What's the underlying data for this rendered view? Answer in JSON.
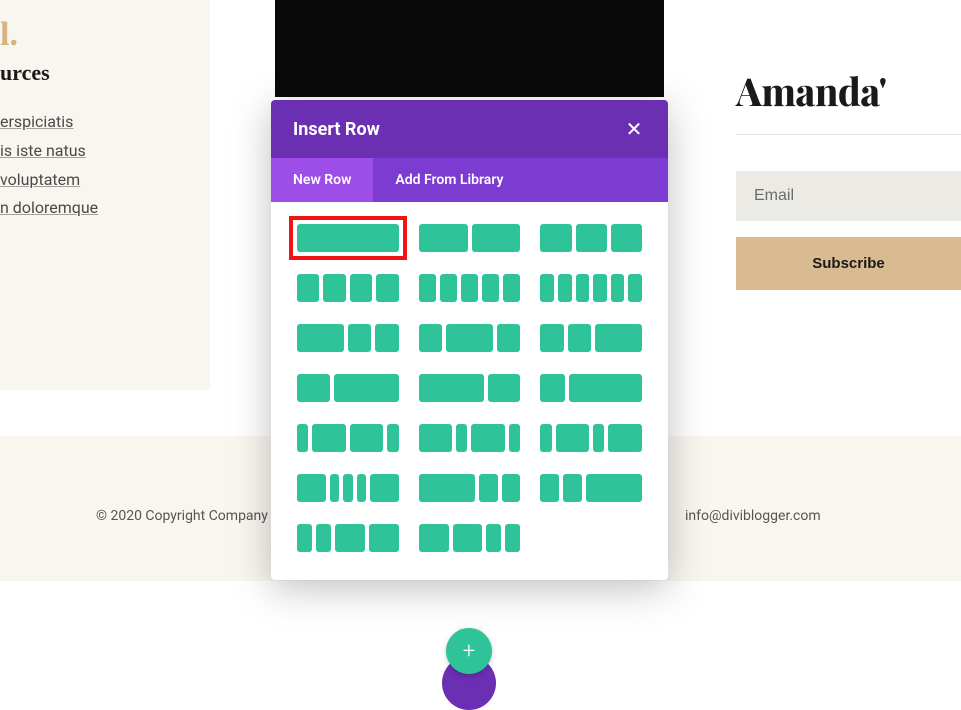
{
  "left": {
    "accent": "l.",
    "heading": "urces",
    "items": [
      "erspiciatis",
      "is iste natus",
      "voluptatem",
      "n doloremque"
    ]
  },
  "right": {
    "title": "Amanda'",
    "email_placeholder": "Email",
    "subscribe_label": "Subscribe"
  },
  "footer": {
    "copyright": "© 2020 Copyright Company",
    "email": "info@diviblogger.com"
  },
  "modal": {
    "title": "Insert Row",
    "close_glyph": "✕",
    "tabs": [
      {
        "label": "New Row",
        "active": true
      },
      {
        "label": "Add From Library",
        "active": false
      }
    ],
    "layouts": [
      {
        "cols": [
          1
        ],
        "highlighted": true
      },
      {
        "cols": [
          1,
          1
        ]
      },
      {
        "cols": [
          1,
          1,
          1
        ]
      },
      {
        "cols": [
          1,
          1,
          1,
          1
        ]
      },
      {
        "cols": [
          1,
          1,
          1,
          1,
          1
        ]
      },
      {
        "cols": [
          1,
          1,
          1,
          1,
          1,
          1
        ]
      },
      {
        "cols": [
          2,
          1,
          1
        ]
      },
      {
        "cols": [
          1,
          2,
          1
        ]
      },
      {
        "cols": [
          1,
          1,
          2
        ]
      },
      {
        "cols": [
          1,
          2
        ]
      },
      {
        "cols": [
          2,
          1
        ]
      },
      {
        "cols": [
          1,
          3
        ]
      },
      {
        "cols": [
          1,
          3,
          3,
          1
        ]
      },
      {
        "cols": [
          3,
          1,
          3,
          1
        ]
      },
      {
        "cols": [
          1,
          3,
          1,
          3
        ]
      },
      {
        "cols": [
          3,
          1,
          1,
          1,
          3
        ]
      },
      {
        "cols": [
          3,
          1,
          1
        ]
      },
      {
        "cols": [
          1,
          1,
          3
        ]
      },
      {
        "cols": [
          1,
          1,
          2,
          2
        ]
      },
      {
        "cols": [
          2,
          2,
          1,
          1
        ]
      },
      {
        "cols": []
      }
    ],
    "plus_glyph": "+"
  }
}
